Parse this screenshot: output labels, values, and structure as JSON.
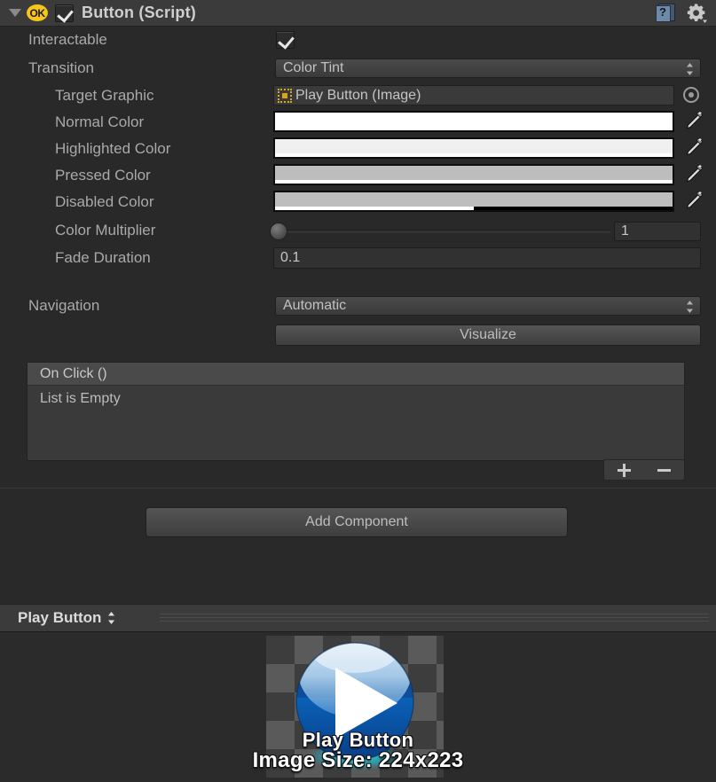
{
  "component": {
    "title": "Button (Script)",
    "status_badge": "OK",
    "enabled": true,
    "foldout_expanded": true,
    "help_icon": "help-book-icon",
    "settings_icon": "gear-icon"
  },
  "fields": {
    "interactable": {
      "label": "Interactable",
      "checked": true
    },
    "transition": {
      "label": "Transition",
      "value": "Color Tint"
    },
    "target_graphic": {
      "label": "Target Graphic",
      "value": "Play Button (Image)",
      "icon": "rect-transform-icon"
    },
    "normal_color": {
      "label": "Normal Color",
      "color": "#ffffff",
      "alpha_pct": 100
    },
    "highlighted_color": {
      "label": "Highlighted Color",
      "color": "#f0f0f0",
      "alpha_pct": 100
    },
    "pressed_color": {
      "label": "Pressed Color",
      "color": "#bdbdbd",
      "alpha_pct": 100
    },
    "disabled_color": {
      "label": "Disabled Color",
      "color": "#bdbdbd",
      "alpha_pct": 50
    },
    "color_multiplier": {
      "label": "Color Multiplier",
      "value": "1",
      "slider_pct": 0
    },
    "fade_duration": {
      "label": "Fade Duration",
      "value": "0.1"
    },
    "navigation": {
      "label": "Navigation",
      "value": "Automatic"
    },
    "visualize_button": "Visualize"
  },
  "events": {
    "header": "On Click ()",
    "empty_text": "List is Empty",
    "add_button": "+",
    "remove_button": "–"
  },
  "add_component_button": "Add Component",
  "preview": {
    "title": "Play Button",
    "overlay_name": "Play Button",
    "overlay_size": "Image Size: 224x223"
  }
}
